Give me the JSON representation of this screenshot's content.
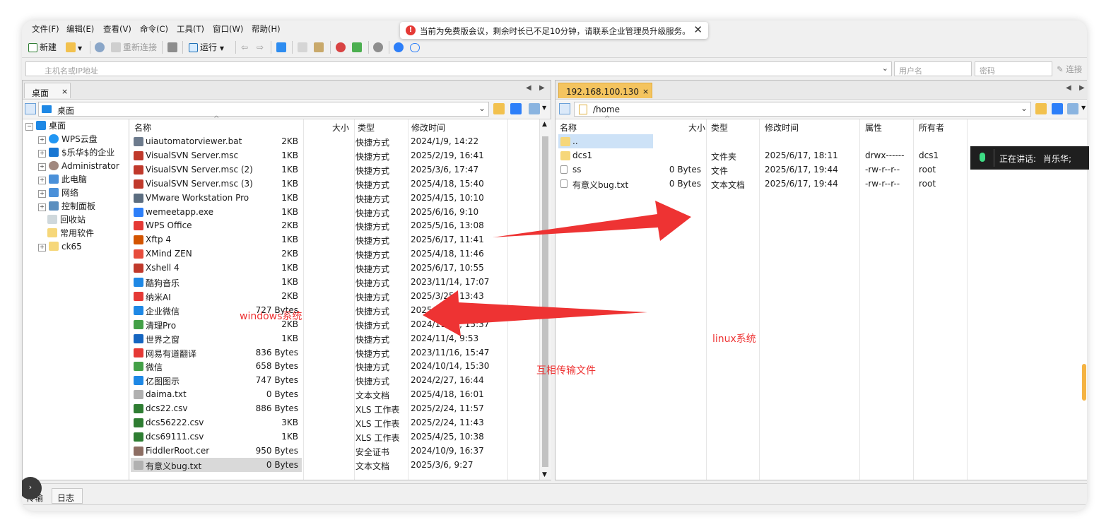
{
  "menu": [
    "文件(F)",
    "编辑(E)",
    "查看(V)",
    "命令(C)",
    "工具(T)",
    "窗口(W)",
    "帮助(H)"
  ],
  "notice": {
    "text": "当前为免费版会议，剩余时长已不足10分钟，请联系企业管理员升级服务。",
    "icon": "!",
    "close": "✕"
  },
  "toolbar": {
    "new": "新建",
    "reconnect": "重新连接",
    "run": "运行"
  },
  "connect": {
    "host_placeholder": "主机名或IP地址",
    "user_placeholder": "用户名",
    "pass_placeholder": "密码",
    "connect_label": "连接"
  },
  "left": {
    "tab": "桌面",
    "tab_close": "×",
    "path": "桌面",
    "tree": [
      {
        "label": "桌面",
        "expander": "−"
      },
      {
        "label": "WPS云盘",
        "expander": "+"
      },
      {
        "label": "$乐华$的企业",
        "expander": "+"
      },
      {
        "label": "Administrator",
        "expander": "+"
      },
      {
        "label": "此电脑",
        "expander": "+"
      },
      {
        "label": "网络",
        "expander": "+"
      },
      {
        "label": "控制面板",
        "expander": "+"
      },
      {
        "label": "回收站",
        "expander": ""
      },
      {
        "label": "常用软件",
        "expander": ""
      },
      {
        "label": "ck65",
        "expander": "+"
      }
    ],
    "columns": {
      "name": "名称",
      "size": "大小",
      "type": "类型",
      "modified": "修改时间"
    },
    "files": [
      {
        "name": "uiautomatorviewer.bat",
        "size": "2KB",
        "type": "快捷方式",
        "modified": "2024/1/9, 14:22",
        "color": "#6d7b8d"
      },
      {
        "name": "VisualSVN Server.msc",
        "size": "1KB",
        "type": "快捷方式",
        "modified": "2025/2/19, 16:41",
        "color": "#c0392b"
      },
      {
        "name": "VisualSVN Server.msc (2)",
        "size": "1KB",
        "type": "快捷方式",
        "modified": "2025/3/6, 17:47",
        "color": "#c0392b"
      },
      {
        "name": "VisualSVN Server.msc (3)",
        "size": "1KB",
        "type": "快捷方式",
        "modified": "2025/4/18, 15:40",
        "color": "#c0392b"
      },
      {
        "name": "VMware Workstation Pro",
        "size": "1KB",
        "type": "快捷方式",
        "modified": "2025/4/15, 10:10",
        "color": "#5b6d80"
      },
      {
        "name": "wemeetapp.exe",
        "size": "1KB",
        "type": "快捷方式",
        "modified": "2025/6/16, 9:10",
        "color": "#2d7ff9"
      },
      {
        "name": "WPS Office",
        "size": "2KB",
        "type": "快捷方式",
        "modified": "2025/5/16, 13:08",
        "color": "#e53935"
      },
      {
        "name": "Xftp 4",
        "size": "1KB",
        "type": "快捷方式",
        "modified": "2025/6/17, 11:41",
        "color": "#d35400"
      },
      {
        "name": "XMind ZEN",
        "size": "2KB",
        "type": "快捷方式",
        "modified": "2025/4/18, 11:46",
        "color": "#e74c3c"
      },
      {
        "name": "Xshell 4",
        "size": "1KB",
        "type": "快捷方式",
        "modified": "2025/6/17, 10:55",
        "color": "#c0392b"
      },
      {
        "name": "酷狗音乐",
        "size": "1KB",
        "type": "快捷方式",
        "modified": "2023/11/14, 17:07",
        "color": "#1e88e5"
      },
      {
        "name": "纳米AI",
        "size": "2KB",
        "type": "快捷方式",
        "modified": "2025/3/25, 13:43",
        "color": "#e53935"
      },
      {
        "name": "企业微信",
        "size": "727 Bytes",
        "type": "快捷方式",
        "modified": "2025/4/18, 11:46",
        "color": "#1e88e5"
      },
      {
        "name": "清理Pro",
        "size": "2KB",
        "type": "快捷方式",
        "modified": "2024/11/14, 15:37",
        "color": "#43a047"
      },
      {
        "name": "世界之窗",
        "size": "1KB",
        "type": "快捷方式",
        "modified": "2024/11/4, 9:53",
        "color": "#1565c0"
      },
      {
        "name": "网易有道翻译",
        "size": "836 Bytes",
        "type": "快捷方式",
        "modified": "2023/11/16, 15:47",
        "color": "#e53935"
      },
      {
        "name": "微信",
        "size": "658 Bytes",
        "type": "快捷方式",
        "modified": "2024/10/14, 15:30",
        "color": "#43a047"
      },
      {
        "name": "亿图图示",
        "size": "747 Bytes",
        "type": "快捷方式",
        "modified": "2024/2/27, 16:44",
        "color": "#1e88e5"
      },
      {
        "name": "daima.txt",
        "size": "0 Bytes",
        "type": "文本文档",
        "modified": "2025/4/18, 16:01",
        "color": "#b0b0b0"
      },
      {
        "name": "dcs22.csv",
        "size": "886 Bytes",
        "type": "XLS 工作表",
        "modified": "2025/2/24, 11:57",
        "color": "#2e7d32"
      },
      {
        "name": "dcs56222.csv",
        "size": "3KB",
        "type": "XLS 工作表",
        "modified": "2025/2/24, 11:43",
        "color": "#2e7d32"
      },
      {
        "name": "dcs69111.csv",
        "size": "1KB",
        "type": "XLS 工作表",
        "modified": "2025/4/25, 10:38",
        "color": "#2e7d32"
      },
      {
        "name": "FiddlerRoot.cer",
        "size": "950 Bytes",
        "type": "安全证书",
        "modified": "2024/10/9, 16:37",
        "color": "#8d6e63"
      },
      {
        "name": "有意义bug.txt",
        "size": "0 Bytes",
        "type": "文本文档",
        "modified": "2025/3/6, 9:27",
        "color": "#b0b0b0"
      }
    ]
  },
  "right": {
    "tab": "192.168.100.130",
    "tab_close": "×",
    "path": "/home",
    "columns": {
      "name": "名称",
      "size": "大小",
      "type": "类型",
      "modified": "修改时间",
      "attr": "属性",
      "owner": "所有者"
    },
    "files": [
      {
        "name": "..",
        "size": "",
        "type": "",
        "modified": "",
        "attr": "",
        "owner": ""
      },
      {
        "name": "dcs1",
        "size": "",
        "type": "文件夹",
        "modified": "2025/6/17, 18:11",
        "attr": "drwx------",
        "owner": "dcs1"
      },
      {
        "name": "ss",
        "size": "0 Bytes",
        "type": "文件",
        "modified": "2025/6/17, 19:44",
        "attr": "-rw-r--r--",
        "owner": "root"
      },
      {
        "name": "有意义bug.txt",
        "size": "0 Bytes",
        "type": "文本文档",
        "modified": "2025/6/17, 19:44",
        "attr": "-rw-r--r--",
        "owner": "root"
      }
    ]
  },
  "annotations": {
    "windows": "windows系统",
    "linux": "linux系统",
    "transfer": "互相传输文件"
  },
  "speaker": {
    "label": "正在讲话:",
    "name": "肖乐华;"
  },
  "bottom_tabs": [
    "传输",
    "日志"
  ]
}
